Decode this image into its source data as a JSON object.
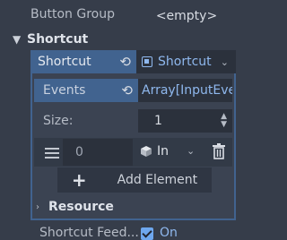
{
  "button_group": {
    "label": "Button Group",
    "value": "<empty>"
  },
  "shortcut_section": {
    "title": "Shortcut"
  },
  "shortcut_prop": {
    "label": "Shortcut",
    "resource_label": "Shortcut"
  },
  "events_prop": {
    "label": "Events",
    "value": "Array[InputEve"
  },
  "size_prop": {
    "label": "Size:",
    "value": "1"
  },
  "array_item": {
    "index_placeholder": "0",
    "type_label": "In"
  },
  "add_element": {
    "label": "Add Element"
  },
  "resource_section": {
    "title": "Resource"
  },
  "shortcut_feedback": {
    "label": "Shortcut Feed...",
    "value": "On",
    "checked": true
  },
  "icons": {
    "revert": "revert-icon",
    "resource": "resource-icon",
    "dropdown": "chevron-down-icon",
    "drag": "drag-handle-icon",
    "cube": "object-icon",
    "trash": "trash-icon",
    "plus": "plus-icon",
    "spinner": "spinner-icon"
  },
  "colors": {
    "accent": "#41638f",
    "link": "#8fb8ee",
    "panel": "#363d4a"
  }
}
